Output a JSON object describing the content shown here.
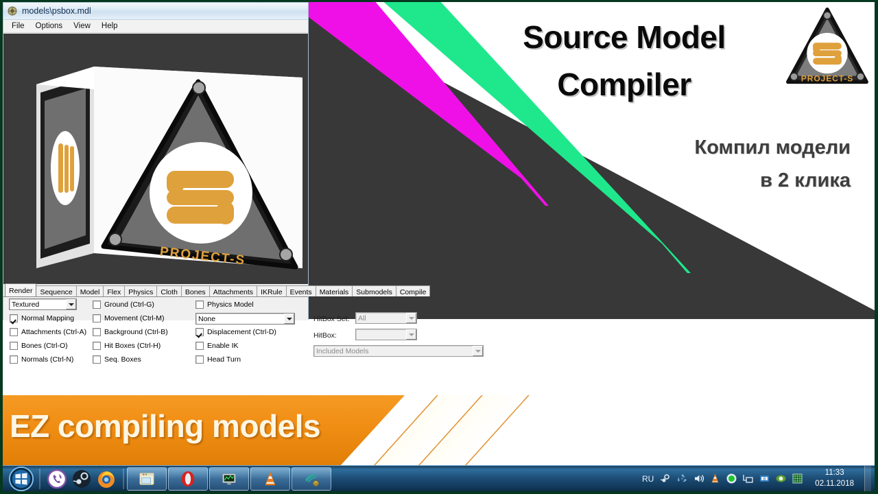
{
  "overlay": {
    "title_line1": "Source Model",
    "title_line2": "Compiler",
    "subtitle_line1": "Компил модели",
    "subtitle_line2": "в 2 клика",
    "banner_text": "EZ compiling models",
    "logo_label": "PROJECT-S",
    "colors": {
      "magenta_stripe": "#ef10e8",
      "green_stripe": "#1fe88c",
      "dark_wedge": "#383838",
      "banner_orange": "#f08d13",
      "logo_orange": "#dfa13c"
    }
  },
  "window": {
    "title": "models\\psbox.mdl",
    "title_icon": "model-file-icon",
    "menu": [
      {
        "label": "File"
      },
      {
        "label": "Options"
      },
      {
        "label": "View"
      },
      {
        "label": "Help"
      }
    ],
    "viewport": {
      "model_name": "psbox",
      "texture_label": "PROJECT-S",
      "background_color": "#3a3a3a"
    },
    "tabs": [
      {
        "label": "Render",
        "active": true
      },
      {
        "label": "Sequence",
        "active": false
      },
      {
        "label": "Model",
        "active": false
      },
      {
        "label": "Flex",
        "active": false
      },
      {
        "label": "Physics",
        "active": false
      },
      {
        "label": "Cloth",
        "active": false
      },
      {
        "label": "Bones",
        "active": false
      },
      {
        "label": "Attachments",
        "active": false
      },
      {
        "label": "IKRule",
        "active": false
      },
      {
        "label": "Events",
        "active": false
      },
      {
        "label": "Materials",
        "active": false
      },
      {
        "label": "Submodels",
        "active": false
      },
      {
        "label": "Compile",
        "active": false
      }
    ],
    "render_panel": {
      "render_mode": "Textured",
      "column1": [
        {
          "label": "Normal Mapping",
          "checked": true
        },
        {
          "label": "Attachments (Ctrl-A)",
          "checked": false
        },
        {
          "label": "Bones (Ctrl-O)",
          "checked": false
        },
        {
          "label": "Normals (Ctrl-N)",
          "checked": false
        }
      ],
      "column2": [
        {
          "label": "Ground (Ctrl-G)",
          "checked": false
        },
        {
          "label": "Movement (Ctrl-M)",
          "checked": false
        },
        {
          "label": "Background (Ctrl-B)",
          "checked": false
        },
        {
          "label": "Hit Boxes (Ctrl-H)",
          "checked": false
        },
        {
          "label": "Seq. Boxes",
          "checked": false
        }
      ],
      "column3": [
        {
          "label": "Physics Model",
          "checked": false
        },
        {
          "label": "Displacement (Ctrl-D)",
          "checked": true
        },
        {
          "label": "Enable IK",
          "checked": false
        },
        {
          "label": "Head Turn",
          "checked": false
        }
      ],
      "physics_combo": "None",
      "hitbox_set_label": "HitBox Set:",
      "hitbox_set_value": "All",
      "hitbox_label": "HitBox:",
      "hitbox_value": "",
      "included_models": "Included Models"
    }
  },
  "taskbar": {
    "start_label": "start-orb",
    "quick_launch": [
      {
        "name": "viber-icon"
      },
      {
        "name": "steam-icon"
      },
      {
        "name": "firefox-icon"
      }
    ],
    "buttons": [
      {
        "name": "taskbar-explorer"
      },
      {
        "name": "taskbar-opera"
      },
      {
        "name": "taskbar-monitor"
      },
      {
        "name": "taskbar-vlc"
      },
      {
        "name": "taskbar-crowbar"
      }
    ],
    "tray": {
      "language": "RU",
      "icons": [
        {
          "name": "steam-tray-icon"
        },
        {
          "name": "amd-tray-icon"
        },
        {
          "name": "volume-tray-icon"
        },
        {
          "name": "vlc-tray-icon"
        },
        {
          "name": "record-tray-icon"
        },
        {
          "name": "network-tray-icon"
        },
        {
          "name": "teamviewer-tray-icon"
        },
        {
          "name": "nvidia-tray-icon"
        },
        {
          "name": "grid-tray-icon"
        }
      ],
      "time": "11:33",
      "date": "02.11.2018"
    }
  }
}
